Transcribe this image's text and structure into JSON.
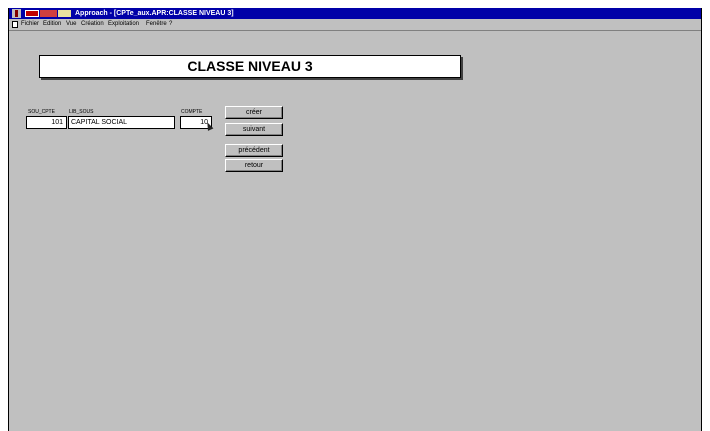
{
  "window": {
    "title": "Approach - [CPTe_aux.APR:CLASSE NIVEAU 3]"
  },
  "menu": [
    "Fichier",
    "Edition",
    "Vue",
    "Création",
    "Exploitation",
    "Fenêtre",
    "?"
  ],
  "form": {
    "heading": "CLASSE NIVEAU 3",
    "fields": {
      "sou_cpte": {
        "label": "SOU_CPTE",
        "value": "101"
      },
      "lib_sous": {
        "label": "LIB_SOUS",
        "value": "CAPITAL SOCIAL"
      },
      "compte": {
        "label": "COMPTE",
        "value": "10"
      }
    },
    "buttons": {
      "creer": "créer",
      "suivant": "suivant",
      "precedent": "précédent",
      "retour": "retour"
    }
  },
  "icons": [
    "app-icon",
    "document-icon",
    "mouse-pointer-icon"
  ]
}
